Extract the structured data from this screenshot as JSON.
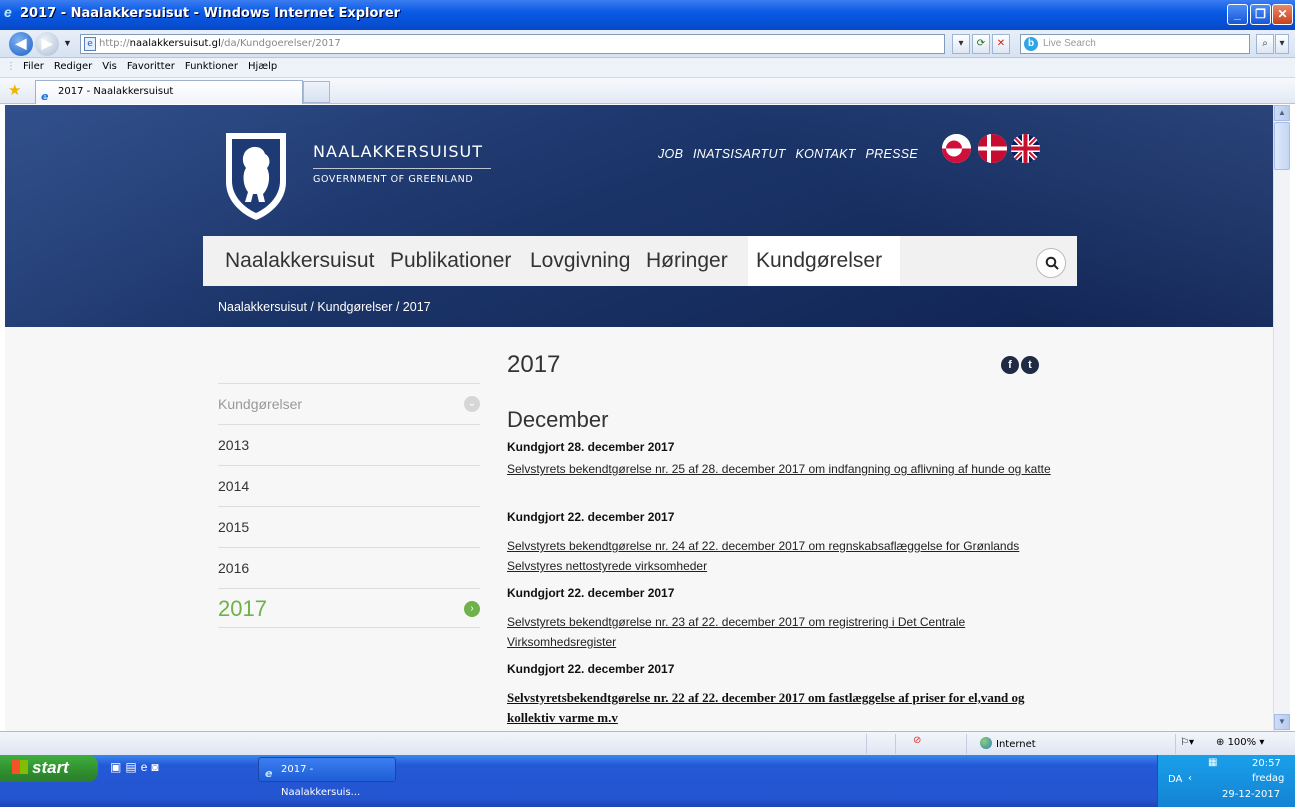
{
  "window": {
    "title": "2017 - Naalakkersuisut - Windows Internet Explorer"
  },
  "address": {
    "url_prefix": "http://",
    "url_host": "naalakkersuisut.gl",
    "url_path": "/da/Kundgoerelser/2017",
    "search_placeholder": "Live Search"
  },
  "menu": {
    "items": [
      "Filer",
      "Rediger",
      "Vis",
      "Favoritter",
      "Funktioner",
      "Hjælp"
    ]
  },
  "tabs": {
    "active_label": "2017 - Naalakkersuisut"
  },
  "site": {
    "brand_name": "NAALAKKERSUISUT",
    "brand_sub": "GOVERNMENT OF GREENLAND",
    "top_links": [
      "JOB",
      "INATSISARTUT",
      "KONTAKT",
      "PRESSE"
    ],
    "nav": [
      "Naalakkersuisut",
      "Publikationer",
      "Lovgivning",
      "Høringer",
      "Kundgørelser"
    ],
    "breadcrumb": "Naalakkersuisut / Kundgørelser / 2017"
  },
  "sidebar": {
    "heading": "Kundgørelser",
    "years": [
      "2013",
      "2014",
      "2015",
      "2016"
    ],
    "current": "2017"
  },
  "content": {
    "title": "2017",
    "month": "December",
    "entries": [
      {
        "date": "Kundgjort 28. december 2017",
        "link": "Selvstyrets bekendtgørelse nr. 25 af 28. december 2017 om indfangning og aflivning af hunde og katte"
      },
      {
        "date": "Kundgjort 22. december 2017",
        "link": "Selvstyrets bekendtgørelse nr. 24 af 22. december 2017 om regnskabsaflæggelse for Grønlands Selvstyres nettostyrede virksomheder"
      },
      {
        "date": "Kundgjort 22. december 2017",
        "link": "Selvstyrets bekendtgørelse nr. 23 af 22. december 2017 om registrering i Det Centrale Virksomhedsregister"
      },
      {
        "date": "Kundgjort 22. december 2017",
        "link": "Selvstyretsbekendtgørelse nr. 22 af 22. december 2017 om fastlæggelse af priser for el,vand og kollektiv varme m.v"
      }
    ]
  },
  "status": {
    "zone": "Internet",
    "zoom": "100%"
  },
  "taskbar": {
    "start_label": "start",
    "task_label": "2017 - Naalakkersuis...",
    "lang": "DA",
    "time": "20:57",
    "day": "fredag",
    "date": "29-12-2017"
  },
  "colors": {
    "accent_green": "#6fb14a",
    "hero_blue": "#1b3468",
    "xp_blue": "#2458d6"
  }
}
